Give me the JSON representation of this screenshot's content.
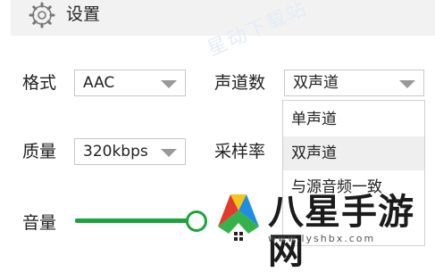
{
  "header": {
    "title": "设置",
    "icon": "gear-icon"
  },
  "watermark": {
    "text": "星动下载站"
  },
  "format": {
    "label": "格式",
    "value": "AAC"
  },
  "channels": {
    "label": "声道数",
    "value": "双声道",
    "options": [
      "单声道",
      "双声道",
      "与源音频一致"
    ],
    "selected_index": 1
  },
  "quality": {
    "label": "质量",
    "value": "320kbps"
  },
  "sample_rate": {
    "label": "采样率"
  },
  "volume": {
    "label": "音量",
    "level_fraction": 1.0,
    "accent": "#1aa43a"
  },
  "logo": {
    "text": "八星手游网",
    "url": "www.lyshbx.com"
  }
}
